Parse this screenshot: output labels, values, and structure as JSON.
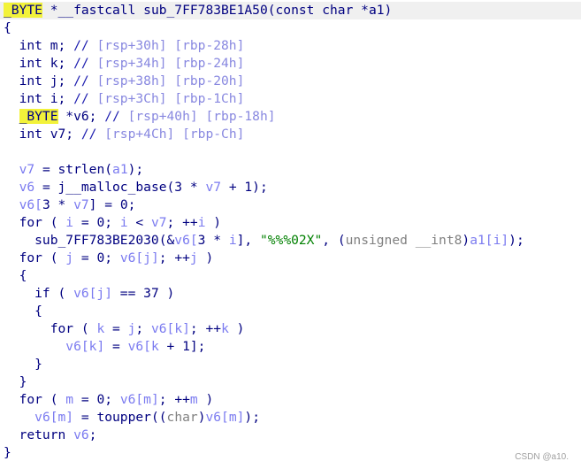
{
  "code": {
    "lines": [
      [
        [
          "_BYTE",
          "h"
        ],
        [
          " *__fastcall sub_7FF783BE1A50(const char *a1)",
          "k"
        ]
      ],
      [
        [
          "{",
          "k"
        ]
      ],
      [
        [
          "  int m; ",
          "k"
        ],
        [
          "// ",
          "c"
        ],
        [
          "[rsp+30h] [rbp-28h]",
          "cb"
        ]
      ],
      [
        [
          "  int k; ",
          "k"
        ],
        [
          "// ",
          "c"
        ],
        [
          "[rsp+34h] [rbp-24h]",
          "cb"
        ]
      ],
      [
        [
          "  int j; ",
          "k"
        ],
        [
          "// ",
          "c"
        ],
        [
          "[rsp+38h] [rbp-20h]",
          "cb"
        ]
      ],
      [
        [
          "  int i; ",
          "k"
        ],
        [
          "// ",
          "c"
        ],
        [
          "[rsp+3Ch] [rbp-1Ch]",
          "cb"
        ]
      ],
      [
        [
          "  ",
          "k"
        ],
        [
          "_BYTE",
          "h"
        ],
        [
          " *v6; ",
          "k"
        ],
        [
          "// ",
          "c"
        ],
        [
          "[rsp+40h] [rbp-18h]",
          "cb"
        ]
      ],
      [
        [
          "  int v7; ",
          "k"
        ],
        [
          "// ",
          "c"
        ],
        [
          "[rsp+4Ch] [rbp-Ch]",
          "cb"
        ]
      ],
      [],
      [
        [
          "  ",
          "k"
        ],
        [
          "v7",
          "v"
        ],
        [
          " = strlen(",
          "k"
        ],
        [
          "a1",
          "v"
        ],
        [
          ");",
          "k"
        ]
      ],
      [
        [
          "  ",
          "k"
        ],
        [
          "v6",
          "v"
        ],
        [
          " = j__malloc_base(3 * ",
          "k"
        ],
        [
          "v7",
          "v"
        ],
        [
          " + 1);",
          "k"
        ]
      ],
      [
        [
          "  ",
          "k"
        ],
        [
          "v6[",
          "v"
        ],
        [
          "3 * ",
          "k"
        ],
        [
          "v7",
          "v"
        ],
        [
          "] = 0;",
          "k"
        ]
      ],
      [
        [
          "  for ( ",
          "k"
        ],
        [
          "i",
          "v"
        ],
        [
          " = 0; ",
          "k"
        ],
        [
          "i",
          "v"
        ],
        [
          " < ",
          "k"
        ],
        [
          "v7",
          "v"
        ],
        [
          "; ++",
          "k"
        ],
        [
          "i",
          "v"
        ],
        [
          " )",
          "k"
        ]
      ],
      [
        [
          "    sub_7FF783BE2030(&",
          "k"
        ],
        [
          "v6[",
          "v"
        ],
        [
          "3 * ",
          "k"
        ],
        [
          "i",
          "v"
        ],
        [
          "], ",
          "k"
        ],
        [
          "\"%%%02X\"",
          "s"
        ],
        [
          ", (",
          "k"
        ],
        [
          "unsigned __int8",
          "t"
        ],
        [
          ")",
          "k"
        ],
        [
          "a1[i]",
          "v"
        ],
        [
          ");",
          "k"
        ]
      ],
      [
        [
          "  for ( ",
          "k"
        ],
        [
          "j",
          "v"
        ],
        [
          " = 0; ",
          "k"
        ],
        [
          "v6[j]",
          "v"
        ],
        [
          "; ++",
          "k"
        ],
        [
          "j",
          "v"
        ],
        [
          " )",
          "k"
        ]
      ],
      [
        [
          "  {",
          "k"
        ]
      ],
      [
        [
          "    if ( ",
          "k"
        ],
        [
          "v6[j]",
          "v"
        ],
        [
          " == 37 )",
          "k"
        ]
      ],
      [
        [
          "    {",
          "k"
        ]
      ],
      [
        [
          "      for ( ",
          "k"
        ],
        [
          "k",
          "v"
        ],
        [
          " = ",
          "k"
        ],
        [
          "j",
          "v"
        ],
        [
          "; ",
          "k"
        ],
        [
          "v6[k]",
          "v"
        ],
        [
          "; ++",
          "k"
        ],
        [
          "k",
          "v"
        ],
        [
          " )",
          "k"
        ]
      ],
      [
        [
          "        ",
          "k"
        ],
        [
          "v6[k]",
          "v"
        ],
        [
          " = ",
          "k"
        ],
        [
          "v6[k",
          "v"
        ],
        [
          " + 1];",
          "k"
        ]
      ],
      [
        [
          "    }",
          "k"
        ]
      ],
      [
        [
          "  }",
          "k"
        ]
      ],
      [
        [
          "  for ( ",
          "k"
        ],
        [
          "m",
          "v"
        ],
        [
          " = 0; ",
          "k"
        ],
        [
          "v6[m]",
          "v"
        ],
        [
          "; ++",
          "k"
        ],
        [
          "m",
          "v"
        ],
        [
          " )",
          "k"
        ]
      ],
      [
        [
          "    ",
          "k"
        ],
        [
          "v6[m]",
          "v"
        ],
        [
          " = toupper((",
          "k"
        ],
        [
          "char",
          "t"
        ],
        [
          ")",
          "k"
        ],
        [
          "v6[m]",
          "v"
        ],
        [
          ");",
          "k"
        ]
      ],
      [
        [
          "  return ",
          "k"
        ],
        [
          "v6",
          "v"
        ],
        [
          ";",
          "k"
        ]
      ],
      [
        [
          "}",
          "k"
        ]
      ]
    ]
  },
  "watermark": "CSDN @a10.",
  "colors": {
    "keyword": "#000080",
    "variable": "#7b7bf0",
    "string": "#008000",
    "type": "#808080",
    "highlight": "#f2f23a"
  }
}
